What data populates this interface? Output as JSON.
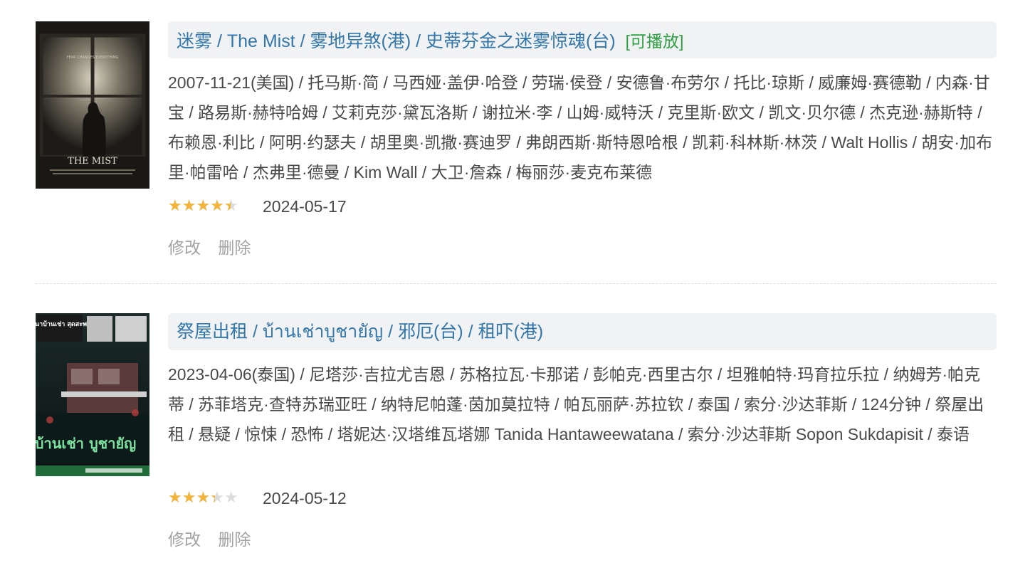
{
  "items": [
    {
      "title": "迷雾 / The Mist / 雾地异煞(港) / 史蒂芬金之迷雾惊魂(台)",
      "playable": "[可播放]",
      "poster_text": "THE MIST",
      "poster_tagline": "FEAR CHANGES EVERYTHING",
      "intro": "2007-11-21(美国) / 托马斯·简 / 马西娅·盖伊·哈登 / 劳瑞·侯登 / 安德鲁·布劳尔 / 托比·琼斯 / 威廉姆·赛德勒 / 内森·甘宝 / 路易斯·赫特哈姆 / 艾莉克莎·黛瓦洛斯 / 谢拉米·李 / 山姆·威特沃 / 克里斯·欧文 / 凯文·贝尔德 / 杰克逊·赫斯特 / 布赖恩·利比 / 阿明·约瑟夫 / 胡里奥·凯撒·赛迪罗 / 弗朗西斯·斯特恩哈根 / 凯莉·科林斯·林茨 / Walt Hollis / 胡安·加布里·帕雷哈 / 杰弗里·德曼 / Kim Wall / 大卫·詹森 / 梅丽莎·麦克布莱德",
      "rating": 4,
      "rating_max": 5,
      "date": "2024-05-17",
      "edit_label": "修改",
      "delete_label": "删除"
    },
    {
      "title": "祭屋出租 / บ้านเช่าบูชายัญ / 邪厄(台) / 租吓(港)",
      "playable": "",
      "poster_text": "บ้านเช่า บูชายัญ",
      "poster_tagline": "ปริศนาบ้านเช่า สุดสะพรึง!",
      "intro": "2023-04-06(泰国) / 尼塔莎·吉拉尤吉恩 / 苏格拉瓦·卡那诺 / 彭帕克·西里古尔 / 坦雅帕特·玛育拉乐拉 / 纳姆芳·帕克蒂 / 苏菲塔克·查特苏瑞亚旺 / 纳特尼帕蓬·茵加莫拉特 / 帕瓦丽萨·苏拉钦 / 泰国 / 索分·沙达菲斯 / 124分钟 / 祭屋出租 / 悬疑 / 惊悚 / 恐怖 / 塔妮达·汉塔维瓦塔娜 Tanida Hantaweewatana / 索分·沙达菲斯 Sopon Sukdapisit / 泰语",
      "rating": 3,
      "rating_max": 5,
      "date": "2024-05-12",
      "edit_label": "修改",
      "delete_label": "删除"
    }
  ],
  "colors": {
    "link": "#3377aa",
    "playable": "#2f9e44",
    "star": "#f4b43a",
    "star_empty": "#dcdcdc",
    "muted": "#a3a3a3"
  }
}
